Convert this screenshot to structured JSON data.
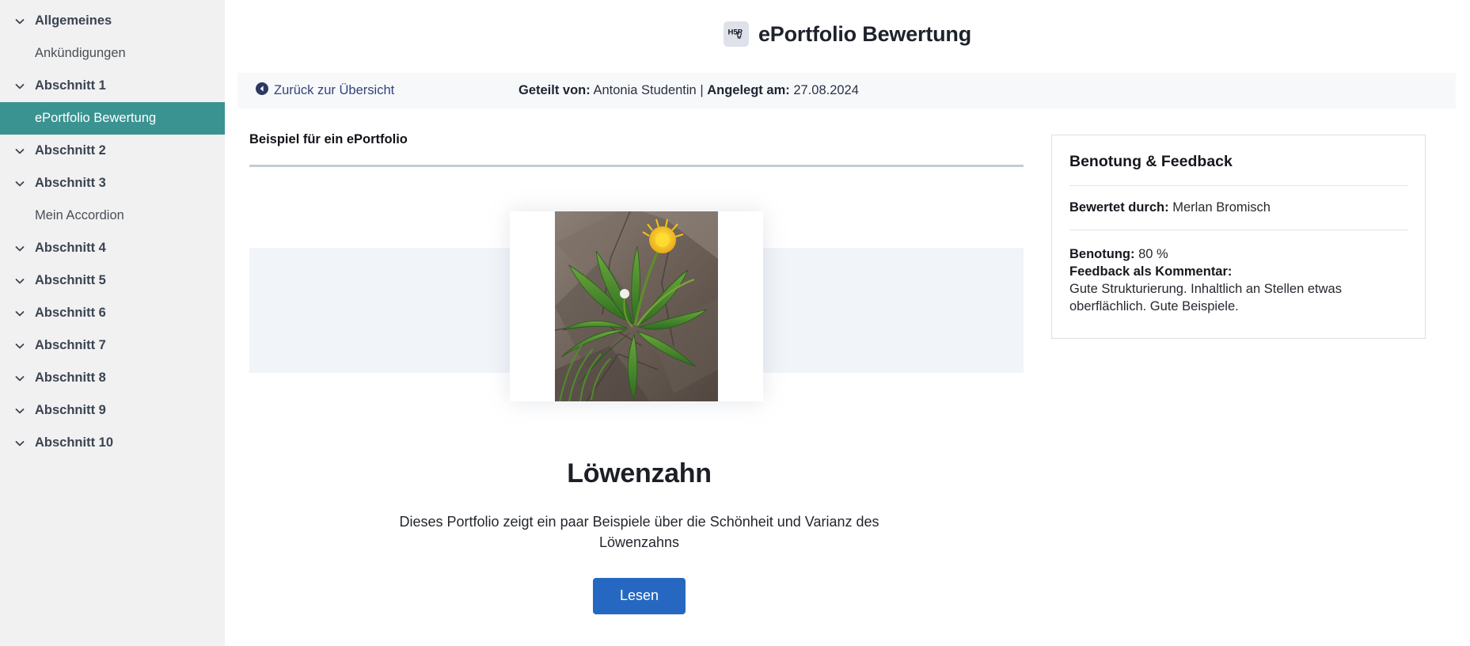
{
  "sidebar": {
    "items": [
      {
        "label": "Allgemeines",
        "type": "section",
        "icon": "chevron-down-icon",
        "expanded": true
      },
      {
        "label": "Ankündigungen",
        "type": "child",
        "active": false
      },
      {
        "label": "Abschnitt 1",
        "type": "section",
        "icon": "chevron-down-icon",
        "expanded": true
      },
      {
        "label": "ePortfolio Bewertung",
        "type": "child",
        "active": true
      },
      {
        "label": "Abschnitt 2",
        "type": "section",
        "icon": "chevron-down-icon",
        "expanded": true
      },
      {
        "label": "Abschnitt 3",
        "type": "section",
        "icon": "chevron-down-icon",
        "expanded": true
      },
      {
        "label": "Mein Accordion",
        "type": "child",
        "active": false
      },
      {
        "label": "Abschnitt 4",
        "type": "section",
        "icon": "chevron-down-icon",
        "expanded": true
      },
      {
        "label": "Abschnitt 5",
        "type": "section",
        "icon": "chevron-down-icon",
        "expanded": true
      },
      {
        "label": "Abschnitt 6",
        "type": "section",
        "icon": "chevron-down-icon",
        "expanded": true
      },
      {
        "label": "Abschnitt 7",
        "type": "section",
        "icon": "chevron-down-icon",
        "expanded": true
      },
      {
        "label": "Abschnitt 8",
        "type": "section",
        "icon": "chevron-down-icon",
        "expanded": true
      },
      {
        "label": "Abschnitt 9",
        "type": "section",
        "icon": "chevron-down-icon",
        "expanded": true
      },
      {
        "label": "Abschnitt 10",
        "type": "section",
        "icon": "chevron-down-icon",
        "expanded": true
      }
    ],
    "active_color": "#3a9391",
    "background": "#f1f1f1"
  },
  "header": {
    "icon": "h5p-icon",
    "icon_text": "H5P",
    "title": "ePortfolio Bewertung"
  },
  "info_bar": {
    "back_icon": "arrow-left-circle-icon",
    "back_label": "Zurück zur Übersicht",
    "shared_by_label": "Geteilt von:",
    "shared_by_value": "Antonia Studentin",
    "separator": "|",
    "created_label": "Angelegt am:",
    "created_value": "27.08.2024"
  },
  "main": {
    "section_heading": "Beispiel für ein ePortfolio",
    "portfolio": {
      "image_alt": "Löwenzahn Foto",
      "title": "Löwenzahn",
      "description": "Dieses Portfolio zeigt ein paar Beispiele über die Schönheit und Varianz des Löwenzahns",
      "button_label": "Lesen",
      "button_color": "#2668c1",
      "band_color": "#f1f4f9"
    }
  },
  "feedback_panel": {
    "title": "Benotung & Feedback",
    "graded_by_label": "Bewertet durch:",
    "graded_by_value": "Merlan Bromisch",
    "grade_label": "Benotung:",
    "grade_value": "80 %",
    "comment_label": "Feedback als Kommentar:",
    "comment_value": "Gute Strukturierung. Inhaltlich an Stellen etwas oberflächlich. Gute Beispiele."
  }
}
